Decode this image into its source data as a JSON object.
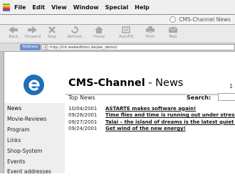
{
  "menubar": {
    "items": [
      "File",
      "Edit",
      "View",
      "Window",
      "Special",
      "Help"
    ]
  },
  "window": {
    "title": "CMS-Channel News"
  },
  "toolbar": {
    "buttons": [
      {
        "label": "Back",
        "icon": "back-arrow-icon"
      },
      {
        "label": "Forward",
        "icon": "forward-arrow-icon"
      },
      {
        "label": "Stop",
        "icon": "stop-icon"
      },
      {
        "label": "Refresh",
        "icon": "refresh-icon"
      },
      {
        "label": "Home",
        "icon": "home-icon"
      },
      {
        "label": "AutoFill",
        "icon": "autofill-icon"
      },
      {
        "label": "Print",
        "icon": "print-icon"
      },
      {
        "label": "Mail",
        "icon": "mail-icon"
      }
    ]
  },
  "address": {
    "label": "Address",
    "url": "http://int.webedition.de/we_demo/"
  },
  "site": {
    "brand": "CMS-Channel",
    "brand_sub": " - News",
    "brand_number": "1",
    "subheading": "Top News",
    "search_label": "Search:"
  },
  "nav": {
    "items": [
      "News",
      "Movie-Reviews",
      "Program",
      "Links",
      "Shop-System",
      "Events",
      "Event addresses"
    ]
  },
  "news": [
    {
      "date": "10/04/2001",
      "title": "ASTARTE makes software again!"
    },
    {
      "date": "09/28/2001",
      "title": "Time flies and time is running out under stress!"
    },
    {
      "date": "09/27/2001",
      "title": "Talai – the island of dreams is the latest quiet tip"
    },
    {
      "date": "09/24/2001",
      "title": "Get wind of the new energy!"
    }
  ],
  "colors": {
    "accent": "#1f6fb8",
    "address_tab": "#6f8fcf",
    "nav_bg": "#eeeeee"
  }
}
